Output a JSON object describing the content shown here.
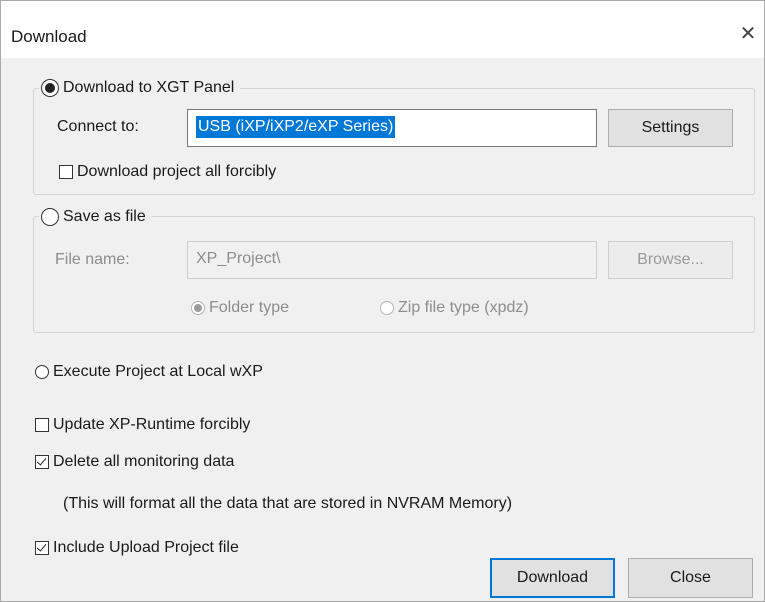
{
  "dialog": {
    "title": "Download"
  },
  "download_group": {
    "radio_label": "Download to XGT Panel",
    "connect_label": "Connect to:",
    "connect_value": "USB (iXP/iXP2/eXP Series)",
    "settings_button": "Settings",
    "force_checkbox_label": "Download project all forcibly",
    "force_checked": false
  },
  "save_group": {
    "radio_label": "Save as file",
    "file_name_label": "File name:",
    "file_name_value": "XP_Project\\",
    "browse_button": "Browse...",
    "folder_type_label": "Folder type",
    "zip_type_label": "Zip file type (xpdz)"
  },
  "execute_local": {
    "label": "Execute Project at Local wXP"
  },
  "options": {
    "update_runtime": {
      "label": "Update XP-Runtime forcibly",
      "checked": false
    },
    "delete_monitoring": {
      "label": "Delete all monitoring data",
      "checked": true
    },
    "delete_note": "(This will format all the data that are stored in NVRAM Memory)",
    "include_upload": {
      "label": "Include Upload Project file",
      "checked": true
    }
  },
  "buttons": {
    "download": "Download",
    "close": "Close"
  }
}
